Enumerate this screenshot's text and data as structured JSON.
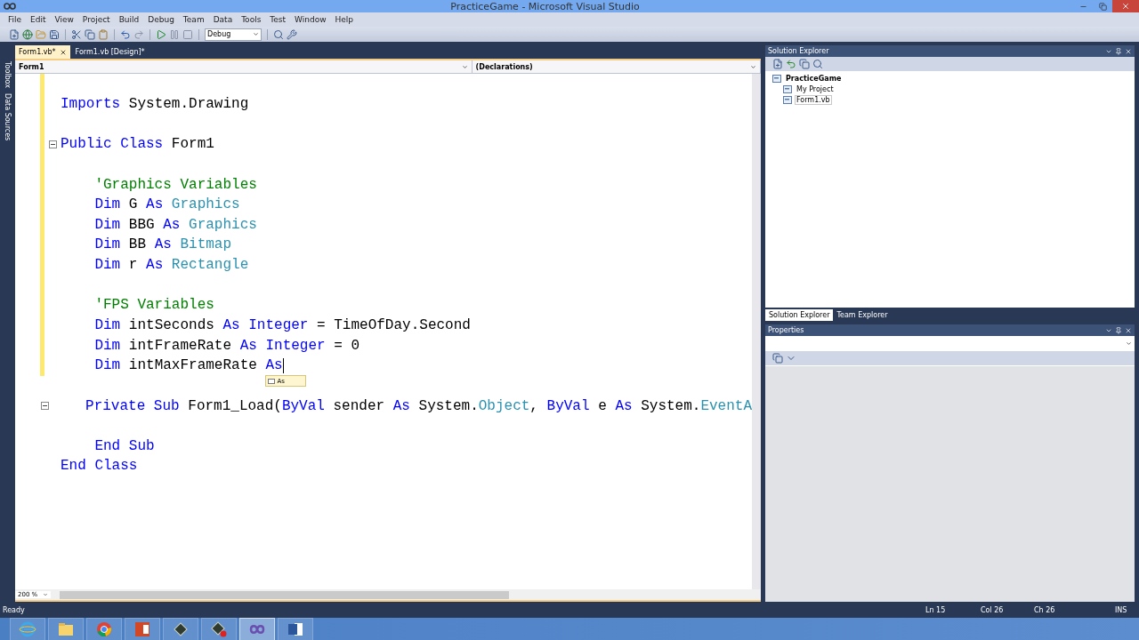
{
  "window": {
    "title": "PracticeGame - Microsoft Visual Studio"
  },
  "menu": [
    "File",
    "Edit",
    "View",
    "Project",
    "Build",
    "Debug",
    "Team",
    "Data",
    "Tools",
    "Test",
    "Window",
    "Help"
  ],
  "toolbar": {
    "configuration": "Debug"
  },
  "side_strip": [
    "Toolbox",
    "Data Sources"
  ],
  "document_tabs": [
    {
      "label": "Form1.vb*",
      "selected": true
    },
    {
      "label": "Form1.vb [Design]*",
      "selected": false
    }
  ],
  "navigation": {
    "type_dropdown": "Form1",
    "member_dropdown": "(Declarations)"
  },
  "code_lines": [
    {
      "modified": true,
      "collapsible": false
    },
    {
      "modified": true,
      "collapsible": false,
      "tokens": [
        {
          "kind": "keyword",
          "text": "Imports"
        },
        {
          "kind": "plain",
          "text": " System.Drawing"
        }
      ]
    },
    {
      "modified": true,
      "collapsible": false
    },
    {
      "modified": true,
      "collapsible": true,
      "tokens": [
        {
          "kind": "keyword",
          "text": "Public Class"
        },
        {
          "kind": "plain",
          "text": " Form1"
        }
      ]
    },
    {
      "modified": true,
      "collapsible": false
    },
    {
      "modified": true,
      "collapsible": false,
      "tokens": [
        {
          "kind": "comment",
          "text": "    'Graphics Variables"
        }
      ]
    },
    {
      "modified": true,
      "collapsible": false,
      "tokens": [
        {
          "kind": "keyword",
          "text": "    Dim"
        },
        {
          "kind": "plain",
          "text": " G "
        },
        {
          "kind": "keyword",
          "text": "As"
        },
        {
          "kind": "type",
          "text": " Graphics"
        }
      ]
    },
    {
      "modified": true,
      "collapsible": false,
      "tokens": [
        {
          "kind": "keyword",
          "text": "    Dim"
        },
        {
          "kind": "plain",
          "text": " BBG "
        },
        {
          "kind": "keyword",
          "text": "As"
        },
        {
          "kind": "type",
          "text": " Graphics"
        }
      ]
    },
    {
      "modified": true,
      "collapsible": false,
      "tokens": [
        {
          "kind": "keyword",
          "text": "    Dim"
        },
        {
          "kind": "plain",
          "text": " BB "
        },
        {
          "kind": "keyword",
          "text": "As"
        },
        {
          "kind": "type",
          "text": " Bitmap"
        }
      ]
    },
    {
      "modified": true,
      "collapsible": false,
      "tokens": [
        {
          "kind": "keyword",
          "text": "    Dim"
        },
        {
          "kind": "plain",
          "text": " r "
        },
        {
          "kind": "keyword",
          "text": "As"
        },
        {
          "kind": "type",
          "text": " Rectangle"
        }
      ]
    },
    {
      "modified": true,
      "collapsible": false
    },
    {
      "modified": true,
      "collapsible": false,
      "tokens": [
        {
          "kind": "comment",
          "text": "    'FPS Variables"
        }
      ]
    },
    {
      "modified": true,
      "collapsible": false,
      "tokens": [
        {
          "kind": "keyword",
          "text": "    Dim"
        },
        {
          "kind": "plain",
          "text": " intSeconds "
        },
        {
          "kind": "keyword",
          "text": "As Integer"
        },
        {
          "kind": "plain",
          "text": " = TimeOfDay.Second"
        }
      ]
    },
    {
      "modified": true,
      "collapsible": false,
      "tokens": [
        {
          "kind": "keyword",
          "text": "    Dim"
        },
        {
          "kind": "plain",
          "text": " intFrameRate "
        },
        {
          "kind": "keyword",
          "text": "As Integer"
        },
        {
          "kind": "plain",
          "text": " = 0"
        }
      ]
    },
    {
      "modified": true,
      "collapsible": false,
      "caret": true,
      "completion": "As",
      "tokens": [
        {
          "kind": "keyword",
          "text": "    Dim"
        },
        {
          "kind": "plain",
          "text": " intMaxFrameRate "
        },
        {
          "kind": "keyword",
          "text": "As"
        }
      ]
    },
    {
      "modified": false,
      "collapsible": false
    },
    {
      "modified": false,
      "collapsible": true,
      "tokens": [
        {
          "kind": "keyword",
          "text": "    Private Sub"
        },
        {
          "kind": "plain",
          "text": " Form1_Load("
        },
        {
          "kind": "keyword",
          "text": "ByVal"
        },
        {
          "kind": "plain",
          "text": " sender "
        },
        {
          "kind": "keyword",
          "text": "As"
        },
        {
          "kind": "plain",
          "text": " System."
        },
        {
          "kind": "type",
          "text": "Object"
        },
        {
          "kind": "plain",
          "text": ", "
        },
        {
          "kind": "keyword",
          "text": "ByVal"
        },
        {
          "kind": "plain",
          "text": " e "
        },
        {
          "kind": "keyword",
          "text": "As"
        },
        {
          "kind": "plain",
          "text": " System."
        },
        {
          "kind": "type",
          "text": "EventA"
        }
      ]
    },
    {
      "modified": false,
      "collapsible": false
    },
    {
      "modified": false,
      "collapsible": false,
      "tokens": [
        {
          "kind": "keyword",
          "text": "    End Sub"
        }
      ]
    },
    {
      "modified": false,
      "collapsible": false,
      "tokens": [
        {
          "kind": "keyword",
          "text": "End Class"
        }
      ]
    }
  ],
  "zoom": "200 %",
  "solution_explorer": {
    "title": "Solution Explorer",
    "tree": [
      {
        "label": "PracticeGame",
        "selected": false,
        "children": [
          {
            "label": "My Project",
            "selected": false
          },
          {
            "label": "Form1.vb",
            "selected": true
          }
        ]
      }
    ]
  },
  "panel_tabs": [
    {
      "label": "Solution Explorer",
      "selected": true
    },
    {
      "label": "Team Explorer",
      "selected": false
    }
  ],
  "properties": {
    "title": "Properties"
  },
  "status_bar": {
    "message": "Ready",
    "line": "Ln 15",
    "column": "Col 26",
    "char": "Ch 26",
    "mode": "INS"
  },
  "taskbar": [
    {
      "kind": "ie",
      "selected": false
    },
    {
      "kind": "folder",
      "selected": false
    },
    {
      "kind": "chrome",
      "selected": false
    },
    {
      "kind": "powerpoint",
      "selected": false
    },
    {
      "kind": "app",
      "selected": false
    },
    {
      "kind": "app-record",
      "selected": false
    },
    {
      "kind": "studio",
      "selected": true
    },
    {
      "kind": "word",
      "selected": false
    }
  ]
}
